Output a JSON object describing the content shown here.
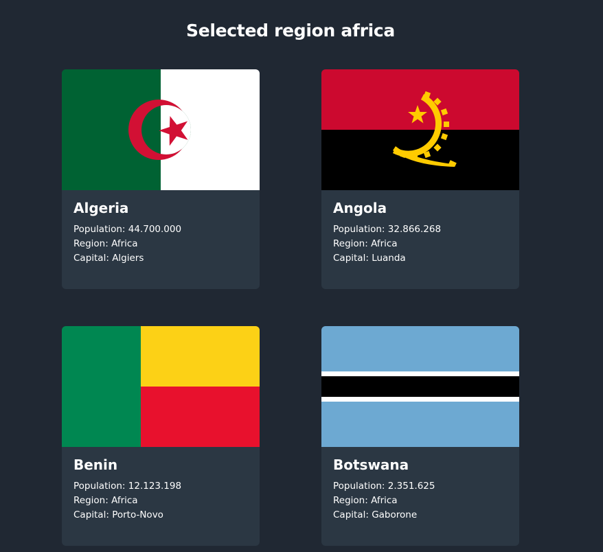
{
  "header": {
    "title": "Selected region africa"
  },
  "countries": [
    {
      "name": "Algeria",
      "population_label": "Population:",
      "population": "44.700.000",
      "region_label": "Region:",
      "region": "Africa",
      "capital_label": "Capital:",
      "capital": "Algiers",
      "flag": "algeria-flag"
    },
    {
      "name": "Angola",
      "population_label": "Population:",
      "population": "32.866.268",
      "region_label": "Region:",
      "region": "Africa",
      "capital_label": "Capital:",
      "capital": "Luanda",
      "flag": "angola-flag"
    },
    {
      "name": "Benin",
      "population_label": "Population:",
      "population": "12.123.198",
      "region_label": "Region:",
      "region": "Africa",
      "capital_label": "Capital:",
      "capital": "Porto-Novo",
      "flag": "benin-flag"
    },
    {
      "name": "Botswana",
      "population_label": "Population:",
      "population": "2.351.625",
      "region_label": "Region:",
      "region": "Africa",
      "capital_label": "Capital:",
      "capital": "Gaborone",
      "flag": "botswana-flag"
    }
  ],
  "colors": {
    "background": "#202833",
    "card": "#2b3743",
    "text": "#ffffff"
  }
}
